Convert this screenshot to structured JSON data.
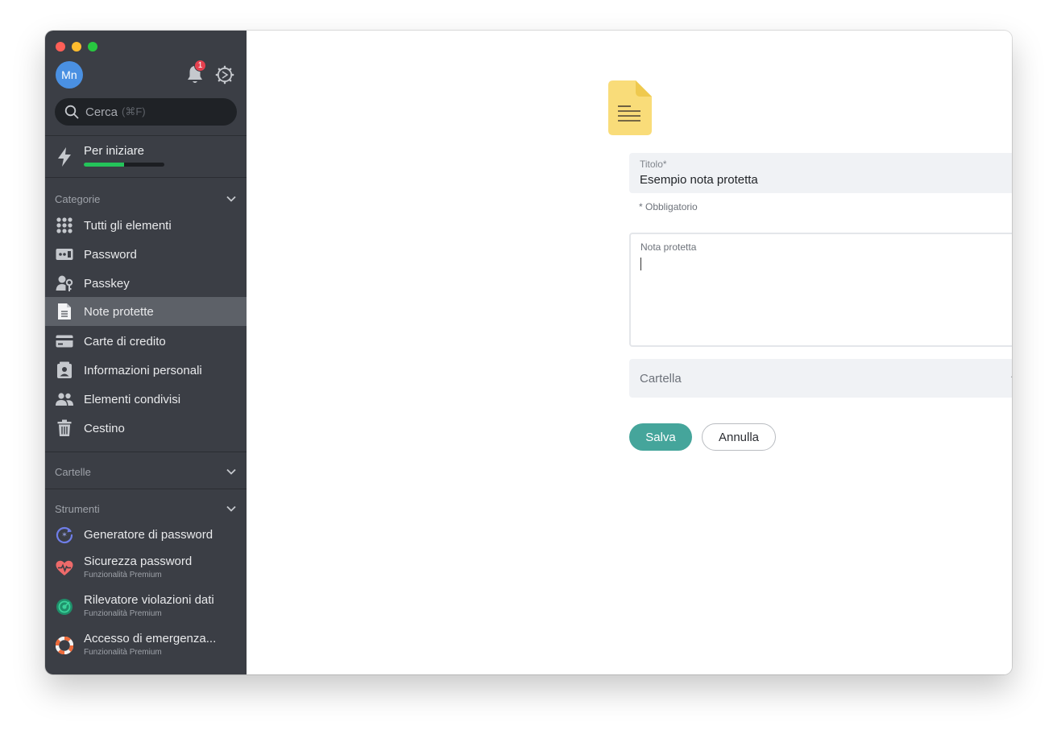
{
  "user": {
    "initials": "Mn"
  },
  "header": {
    "notification_count": "1"
  },
  "search": {
    "placeholder": "Cerca",
    "shortcut": "(⌘F)"
  },
  "getting_started": {
    "label": "Per iniziare",
    "progress_percent": 50
  },
  "categories": {
    "title": "Categorie",
    "items": [
      {
        "label": "Tutti gli elementi",
        "icon": "grid-icon"
      },
      {
        "label": "Password",
        "icon": "password-icon"
      },
      {
        "label": "Passkey",
        "icon": "passkey-icon"
      },
      {
        "label": "Note protette",
        "icon": "note-icon",
        "active": true
      },
      {
        "label": "Carte di credito",
        "icon": "credit-card-icon"
      },
      {
        "label": "Informazioni personali",
        "icon": "personal-info-icon"
      },
      {
        "label": "Elementi condivisi",
        "icon": "shared-users-icon"
      },
      {
        "label": "Cestino",
        "icon": "trash-icon"
      }
    ]
  },
  "folders": {
    "title": "Cartelle"
  },
  "tools": {
    "title": "Strumenti",
    "items": [
      {
        "label": "Generatore di password",
        "subtitle": "",
        "icon": "password-generator-icon"
      },
      {
        "label": "Sicurezza password",
        "subtitle": "Funzionalità Premium",
        "icon": "heart-pulse-icon"
      },
      {
        "label": "Rilevatore violazioni dati",
        "subtitle": "Funzionalità Premium",
        "icon": "radar-icon"
      },
      {
        "label": "Accesso di emergenza...",
        "subtitle": "Funzionalità Premium",
        "icon": "lifebuoy-icon"
      }
    ]
  },
  "form": {
    "title_label": "Titolo*",
    "title_value": "Esempio nota protetta",
    "required_note": "* Obbligatorio",
    "note_label": "Nota protetta",
    "note_value": "",
    "folder_placeholder": "Cartella",
    "save_label": "Salva",
    "cancel_label": "Annulla"
  },
  "colors": {
    "sidebar_bg": "#3b3e45",
    "sidebar_active": "#5d6168",
    "accent_teal": "#45a59b",
    "progress_green": "#24c35a",
    "badge_red": "#e5404f"
  }
}
